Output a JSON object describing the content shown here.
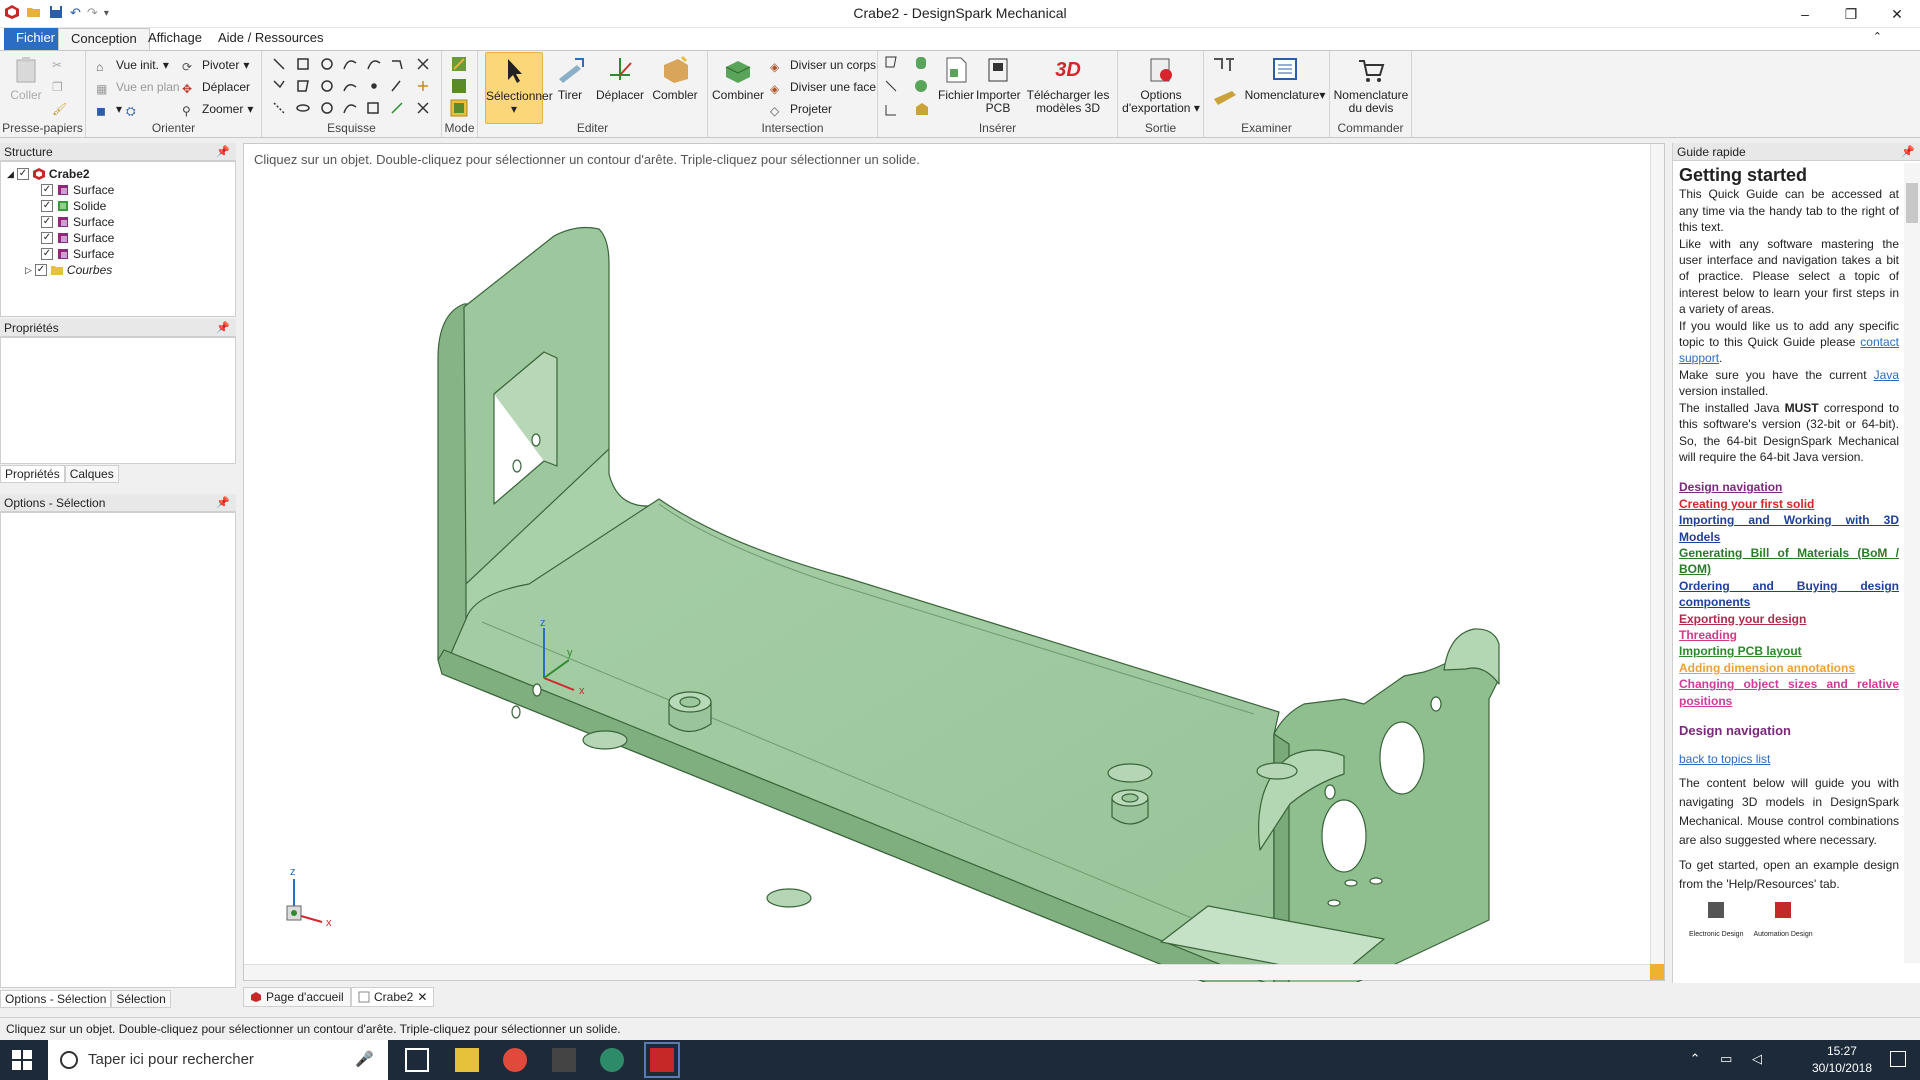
{
  "window": {
    "title": "Crabe2 - DesignSpark Mechanical",
    "minimize": "–",
    "maximize": "❐",
    "close": "✕"
  },
  "ribbon_tabs": [
    "Fichier",
    "Conception",
    "Affichage",
    "Aide / Ressources"
  ],
  "ribbon": {
    "clipboard": {
      "label": "Presse-papiers",
      "paste": "Coller"
    },
    "orient": {
      "label": "Orienter",
      "vue_init": "Vue init.",
      "vue_plan": "Vue en plan",
      "pivoter": "Pivoter",
      "deplacer": "Déplacer",
      "zoomer": "Zoomer"
    },
    "sketch": {
      "label": "Esquisse"
    },
    "mode": {
      "label": "Mode"
    },
    "edit": {
      "label": "Editer",
      "select": "Sélectionner",
      "pull": "Tirer",
      "move": "Déplacer",
      "fill": "Combler"
    },
    "intersect": {
      "label": "Intersection",
      "combine": "Combiner",
      "split_body": "Diviser un corps",
      "split_face": "Diviser une face",
      "project": "Projeter"
    },
    "insert": {
      "label": "Insérer",
      "file": "Fichier",
      "import_pcb": "Importer PCB",
      "download3d_1": "Télécharger les",
      "download3d_2": "modèles 3D",
      "badge3d": "3D"
    },
    "output": {
      "label": "Sortie",
      "export_1": "Options",
      "export_2": "d'exportation"
    },
    "examine": {
      "label": "Examiner",
      "bom": "Nomenclature"
    },
    "order": {
      "label": "Commander",
      "quote_1": "Nomenclature",
      "quote_2": "du devis"
    }
  },
  "structure": {
    "title": "Structure",
    "root": "Crabe2",
    "items": [
      "Surface",
      "Solide",
      "Surface",
      "Surface",
      "Surface",
      "Courbes"
    ]
  },
  "properties": {
    "title": "Propriétés",
    "tabs": [
      "Propriétés",
      "Calques"
    ]
  },
  "options": {
    "title": "Options - Sélection",
    "tabs": [
      "Options - Sélection",
      "Sélection"
    ]
  },
  "viewport": {
    "hint": "Cliquez sur un objet. Double-cliquez pour sélectionner un contour d'arête. Triple-cliquez pour sélectionner un solide.",
    "axis_x": "x",
    "axis_y": "y",
    "axis_z": "z",
    "triad_x": "x",
    "triad_z": "z"
  },
  "guide": {
    "panel_title": "Guide rapide",
    "heading": "Getting started",
    "p1": "This Quick Guide can be accessed at any time via the handy tab to the right of this text.",
    "p2": "Like with any software mastering the user interface and navigation takes a bit of practice. Please select a topic of interest below to learn your first steps in a variety of areas.",
    "p3_pre": "If you would like us to add any specific topic to this Quick Guide please ",
    "p3_link": "contact support",
    "p3_post": ".",
    "p4_pre": "Make sure you have the current ",
    "p4_link": "Java",
    "p4_post": " version installed.",
    "p5_pre": "The installed Java ",
    "p5_bold": "MUST",
    "p5_post": " correspond to this software's version (32-bit or 64-bit). So, the 64-bit DesignSpark Mechanical will require the 64-bit Java version.",
    "topics": [
      {
        "label": "Design navigation",
        "color": "#7a2a7a"
      },
      {
        "label": "Creating your first solid",
        "color": "#d4262c"
      },
      {
        "label": "Importing and Working with 3D Models",
        "color": "#1f3f9a"
      },
      {
        "label": "Generating Bill of Materials (BoM / BOM)",
        "color": "#2a7a2a"
      },
      {
        "label": "Ordering and Buying design components",
        "color": "#1f3f9a"
      },
      {
        "label": "Exporting your design",
        "color": "#b02a4a"
      },
      {
        "label": "Threading",
        "color": "#d23a8a"
      },
      {
        "label": "Importing PCB layout",
        "color": "#2a8a2a"
      },
      {
        "label": "Adding dimension annotations",
        "color": "#f0a030"
      },
      {
        "label": "Changing object sizes and relative positions",
        "color": "#d23a9a"
      }
    ],
    "section_title": "Design navigation",
    "back_link": "back to topics list",
    "p6": "The content below will guide you with navigating 3D models in DesignSpark Mechanical. Mouse control combinations are also suggested where necessary.",
    "p7": "To get started, open an example design from the 'Help/Resources' tab.",
    "thumb1": "Electronic Design",
    "thumb2": "Automation Design"
  },
  "doc_tabs": [
    "Page d'accueil",
    "Crabe2"
  ],
  "status": {
    "text": "Cliquez sur un objet. Double-cliquez pour sélectionner un contour d'arête. Triple-cliquez pour sélectionner un solide."
  },
  "taskbar": {
    "search_placeholder": "Taper ici pour rechercher",
    "time": "15:27",
    "date": "30/10/2018"
  },
  "colors": {
    "part_fill": "#9dc79d",
    "part_shade": "#8ab88a",
    "part_edge": "#2f5a2f",
    "accent": "#2b6cc4"
  }
}
